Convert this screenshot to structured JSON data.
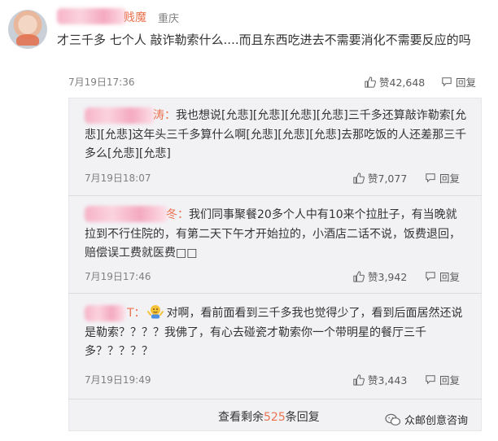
{
  "main_comment": {
    "name_tail": "贱魔",
    "location": "重庆",
    "text": "才三千多 七个人 敲诈勒索什么....而且东西吃进去不需要消化不需要反应的吗",
    "time": "7月19日17:36",
    "likes": "赞42,648",
    "reply_label": "回复"
  },
  "replies": [
    {
      "name_tail": "涛：",
      "text": "我也想说[允悲][允悲][允悲][允悲]三千多还算敲诈勒索[允悲][允悲]这年头三千多算什么啊[允悲][允悲][允悲]去那吃饭的人还差那三千多么[允悲][允悲]",
      "time": "7月19日18:07",
      "likes": "赞7,077",
      "reply_label": "回复"
    },
    {
      "name_tail": "冬：",
      "text": "我们同事聚餐20多个人中有10来个拉肚子，有当晚就拉到不行住院的，有第二天下午才开始拉的，小酒店二话不说，饭费退回，赔偿误工费就医费□□",
      "time": "7月19日17:46",
      "likes": "赞3,942",
      "reply_label": "回复"
    },
    {
      "name_tail": "T：",
      "text": "对啊，看前面看到三千多我也觉得少了，看到后面居然还说是勒索？？？？我佛了，有心去碰瓷才勒索你一个带明星的餐厅三千多？？？？？",
      "time": "7月19日19:49",
      "likes": "赞3,443",
      "reply_label": "回复"
    }
  ],
  "more": {
    "prefix": "查看剩余",
    "count": "525",
    "suffix": "条回复"
  },
  "watermark": "众邮创意咨询",
  "colors": {
    "accent": "#eb7350",
    "panel": "#f2f2f5"
  }
}
